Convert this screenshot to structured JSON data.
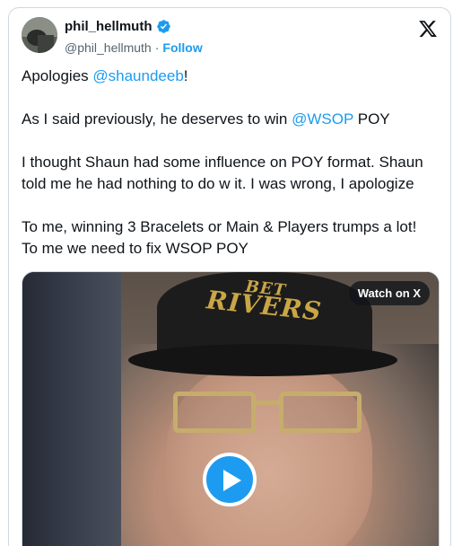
{
  "author": {
    "name": "phil_hellmuth",
    "handle": "@phil_hellmuth",
    "separator": "·",
    "follow_label": "Follow"
  },
  "tweet": {
    "line1_prefix": "Apologies ",
    "line1_mention": "@shaundeeb",
    "line1_suffix": "!",
    "line2_prefix": "As I said previously, he deserves to win ",
    "line2_mention": "@WSOP",
    "line2_suffix": " POY",
    "para3": "I thought Shaun had some influence on POY format. Shaun told me he had nothing to do w it. I was wrong, I apologize",
    "para4_line1": "To me, winning 3 Bracelets or Main & Players trumps a lot!",
    "para4_line2": "To me we need to fix WSOP POY"
  },
  "media": {
    "watch_label": "Watch on X",
    "cap_text_top": "BET",
    "cap_text_main": "RIVERS"
  },
  "colors": {
    "accent": "#1d9bf0",
    "text": "#0f1419",
    "muted": "#536471"
  },
  "icons": [
    "verified-badge-icon",
    "x-logo-icon",
    "play-icon"
  ]
}
